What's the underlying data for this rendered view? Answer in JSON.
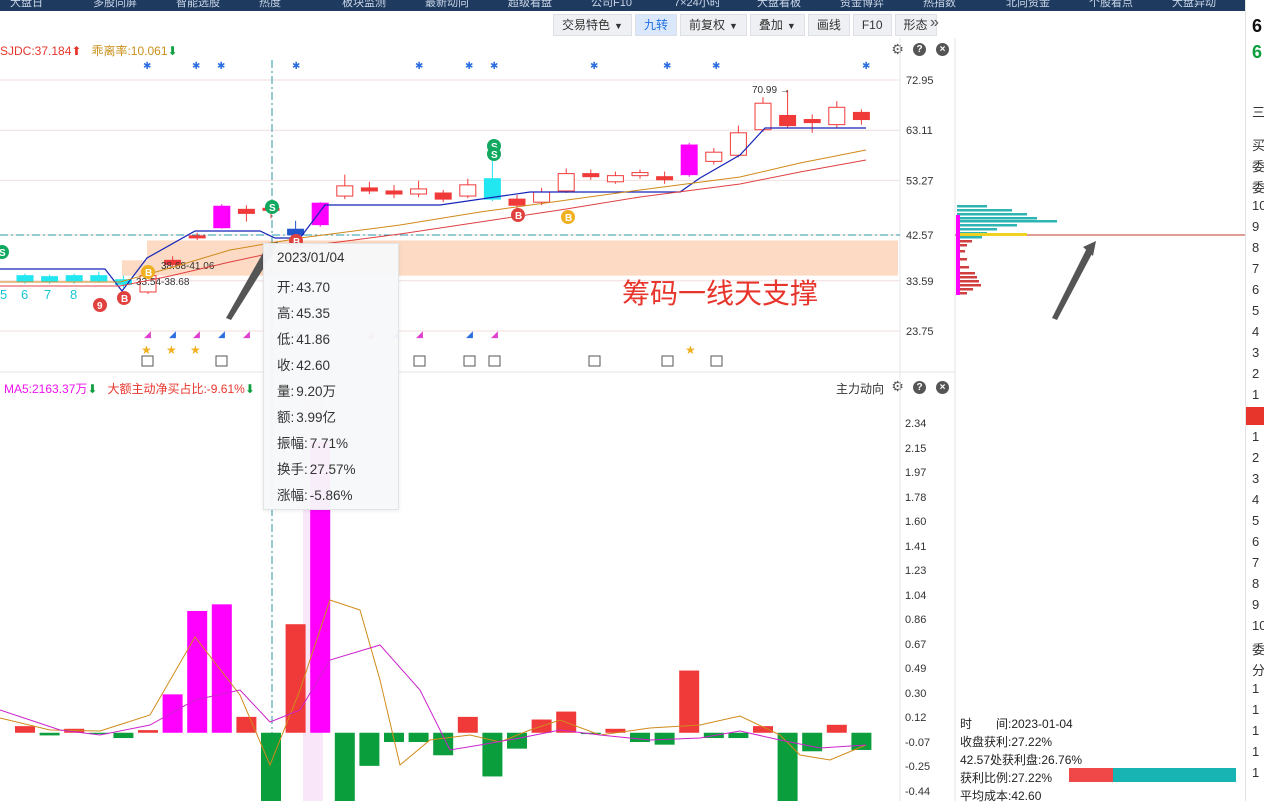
{
  "nav": [
    "大盘日",
    "多股同屏",
    "智能选股",
    "热度",
    "板块监测",
    "最新动向",
    "超级看盘",
    "公司F10",
    "7×24小时",
    "大盘看板",
    "资金博弈",
    "热指数",
    "北向资金",
    "个股看点",
    "大盘异动"
  ],
  "toolbar": [
    {
      "label": "交易特色",
      "caret": "▼"
    },
    {
      "label": "九转",
      "caret": ""
    },
    {
      "label": "前复权",
      "caret": "▼"
    },
    {
      "label": "叠加",
      "caret": "▼"
    },
    {
      "label": "画线",
      "caret": ""
    },
    {
      "label": "F10",
      "caret": ""
    },
    {
      "label": "形态",
      "caret": ""
    }
  ],
  "more_icon": "»",
  "upper_indicator": {
    "a": "SJDC:37.184",
    "a_arrow": "⬆",
    "b": "乖离率:10.061",
    "b_arrow": "⬇"
  },
  "lower_indicator": {
    "a": "MA5:2163.37万",
    "a_arrow": "⬇",
    "b": "大额主动净买占比:-9.61%",
    "b_arrow": "⬇",
    "title": "主力动向"
  },
  "colors": {
    "up": "#f03a3a",
    "down": "#0a9e3c",
    "magenta": "#ff00ff",
    "cyan": "#22e6f0",
    "chip_band": "#fbd3b8"
  },
  "price_axis": [
    "72.95",
    "63.11",
    "53.27",
    "42.57",
    "33.59",
    "23.75"
  ],
  "vol_axis": [
    "2.34",
    "2.15",
    "1.97",
    "1.78",
    "1.60",
    "1.41",
    "1.23",
    "1.04",
    "0.86",
    "0.67",
    "0.49",
    "0.30",
    "0.12",
    "-0.07",
    "-0.25",
    "-0.44"
  ],
  "labels": {
    "high": "70.99",
    "band_a": "38.68-41.06",
    "band_b": "33.54-38.68",
    "nine_digits": [
      "5",
      "6",
      "7",
      "8"
    ]
  },
  "tooltip": [
    {
      "k": "",
      "v": "2023/01/04"
    },
    {
      "k": "开:",
      "v": "43.70"
    },
    {
      "k": "高:",
      "v": "45.35"
    },
    {
      "k": "低:",
      "v": "41.86"
    },
    {
      "k": "收:",
      "v": "42.60"
    },
    {
      "k": "量:",
      "v": "9.20万"
    },
    {
      "k": "额:",
      "v": "3.99亿"
    },
    {
      "k": "振幅:",
      "v": "7.71%"
    },
    {
      "k": "换手:",
      "v": "27.57%"
    },
    {
      "k": "涨幅:",
      "v": "-5.86%"
    }
  ],
  "annotation": "筹码一线天支撑",
  "chip_stats": {
    "time": "时　　间:2023-01-04",
    "profit": "收盘获利:27.22%",
    "at_price": "42.57处获利盘:26.76%",
    "ratio": "获利比例:27.22%",
    "avg": "平均成本:42.60"
  },
  "right_panel": [
    "6",
    "6",
    "三",
    "买",
    "委",
    "委",
    "10",
    "9",
    "8",
    "7",
    "6",
    "5",
    "4",
    "3",
    "2",
    "1",
    "",
    "1",
    "2",
    "3",
    "4",
    "5",
    "6",
    "7",
    "8",
    "9",
    "10",
    "委",
    "分",
    "1",
    "1",
    "1",
    "1",
    "1"
  ],
  "chart_data": {
    "type": "candlestick",
    "dates_visible": [
      "2023/01/04"
    ],
    "price_axis_ticks": [
      72.95,
      63.11,
      53.27,
      42.57,
      33.59,
      23.75
    ],
    "candles": [
      {
        "o": 34.6,
        "c": 33.4,
        "h": 35.0,
        "l": 33.0,
        "dir": "down"
      },
      {
        "o": 34.4,
        "c": 33.4,
        "h": 34.8,
        "l": 33.0,
        "dir": "down"
      },
      {
        "o": 34.6,
        "c": 33.6,
        "h": 35.0,
        "l": 33.0,
        "dir": "down"
      },
      {
        "o": 34.6,
        "c": 33.6,
        "h": 35.4,
        "l": 33.2,
        "dir": "down"
      },
      {
        "o": 33.8,
        "c": 32.9,
        "h": 34.6,
        "l": 32.2,
        "dir": "down"
      },
      {
        "o": 31.4,
        "c": 34.6,
        "h": 35.0,
        "l": 31.0,
        "dir": "hollow"
      },
      {
        "o": 36.8,
        "c": 37.6,
        "h": 38.4,
        "l": 36.4,
        "dir": "up"
      },
      {
        "o": 42.0,
        "c": 42.4,
        "h": 43.0,
        "l": 41.6,
        "dir": "up"
      },
      {
        "o": 44.0,
        "c": 48.2,
        "h": 48.6,
        "l": 43.8,
        "dir": "mag"
      },
      {
        "o": 46.8,
        "c": 47.6,
        "h": 48.4,
        "l": 45.2,
        "dir": "up"
      },
      {
        "o": 47.4,
        "c": 47.8,
        "h": 48.0,
        "l": 45.8,
        "dir": "up"
      },
      {
        "o": 43.7,
        "c": 42.6,
        "h": 45.35,
        "l": 41.86,
        "dir": "down_sel"
      },
      {
        "o": 44.6,
        "c": 48.8,
        "h": 49.0,
        "l": 44.2,
        "dir": "mag"
      },
      {
        "o": 50.2,
        "c": 52.2,
        "h": 54.4,
        "l": 49.6,
        "dir": "hollow"
      },
      {
        "o": 51.2,
        "c": 51.8,
        "h": 53.0,
        "l": 50.6,
        "dir": "up"
      },
      {
        "o": 50.6,
        "c": 51.2,
        "h": 52.4,
        "l": 49.8,
        "dir": "up"
      },
      {
        "o": 50.6,
        "c": 51.6,
        "h": 53.2,
        "l": 50.0,
        "dir": "hollow"
      },
      {
        "o": 49.6,
        "c": 50.8,
        "h": 51.4,
        "l": 49.0,
        "dir": "up"
      },
      {
        "o": 50.2,
        "c": 52.4,
        "h": 53.6,
        "l": 49.8,
        "dir": "hollow"
      },
      {
        "o": 49.6,
        "c": 53.6,
        "h": 57.4,
        "l": 49.2,
        "dir": "cyan"
      },
      {
        "o": 48.4,
        "c": 49.6,
        "h": 50.4,
        "l": 47.6,
        "dir": "up"
      },
      {
        "o": 49.0,
        "c": 51.0,
        "h": 51.8,
        "l": 48.4,
        "dir": "hollow"
      },
      {
        "o": 51.2,
        "c": 54.6,
        "h": 55.6,
        "l": 50.8,
        "dir": "hollow"
      },
      {
        "o": 54.0,
        "c": 54.6,
        "h": 55.4,
        "l": 53.4,
        "dir": "up"
      },
      {
        "o": 53.0,
        "c": 54.2,
        "h": 55.0,
        "l": 52.6,
        "dir": "hollow"
      },
      {
        "o": 54.2,
        "c": 54.8,
        "h": 55.4,
        "l": 53.6,
        "dir": "hollow"
      },
      {
        "o": 53.4,
        "c": 54.0,
        "h": 55.0,
        "l": 52.6,
        "dir": "up"
      },
      {
        "o": 54.4,
        "c": 60.2,
        "h": 60.6,
        "l": 54.0,
        "dir": "mag"
      },
      {
        "o": 57.0,
        "c": 58.8,
        "h": 59.6,
        "l": 56.4,
        "dir": "hollow"
      },
      {
        "o": 58.2,
        "c": 62.6,
        "h": 64.0,
        "l": 57.8,
        "dir": "hollow"
      },
      {
        "o": 63.2,
        "c": 68.4,
        "h": 69.6,
        "l": 62.8,
        "dir": "hollow"
      },
      {
        "o": 66.0,
        "c": 64.0,
        "h": 70.99,
        "l": 63.6,
        "dir": "up"
      },
      {
        "o": 64.6,
        "c": 65.2,
        "h": 66.2,
        "l": 62.6,
        "dir": "up"
      },
      {
        "o": 64.2,
        "c": 67.6,
        "h": 68.8,
        "l": 63.6,
        "dir": "hollow"
      },
      {
        "o": 66.6,
        "c": 65.2,
        "h": 67.2,
        "l": 64.2,
        "dir": "up"
      }
    ],
    "volume_bars": [
      0.05,
      -0.02,
      0.03,
      -0.01,
      -0.04,
      0.02,
      0.29,
      0.92,
      0.97,
      0.12,
      -0.62,
      0.82,
      2.2,
      -0.55,
      -0.25,
      -0.07,
      -0.07,
      -0.17,
      0.12,
      -0.33,
      -0.12,
      0.1,
      0.16,
      -0.01,
      0.03,
      -0.07,
      -0.09,
      0.47,
      -0.04,
      -0.04,
      0.05,
      -0.62,
      -0.14,
      0.06,
      -0.13
    ]
  }
}
